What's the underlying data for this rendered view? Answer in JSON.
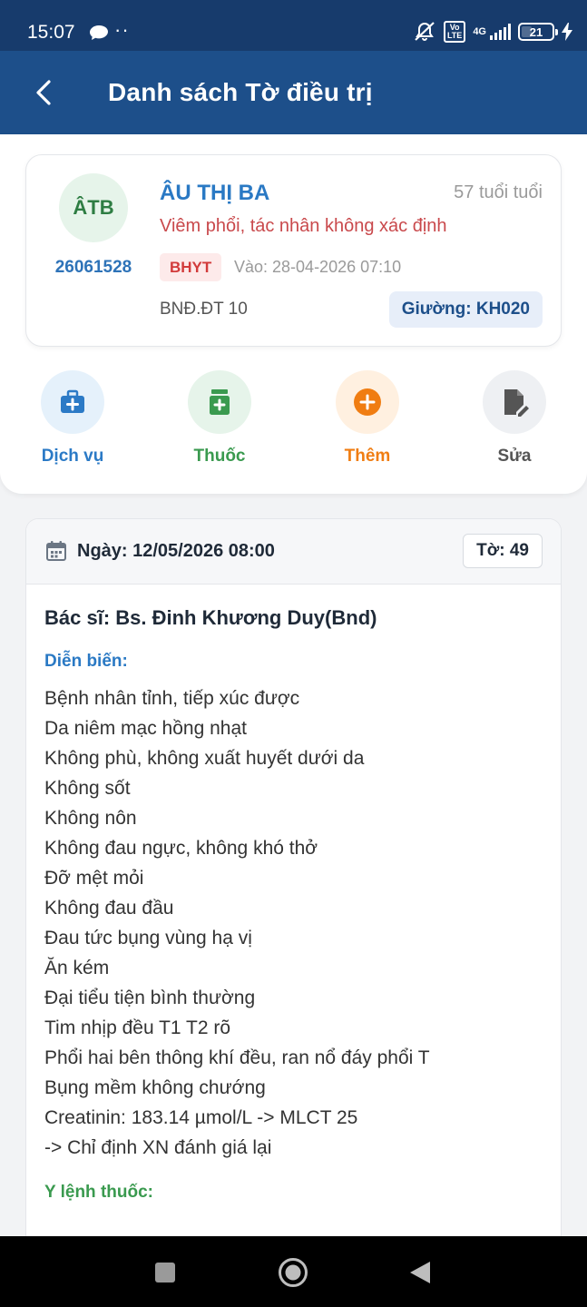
{
  "status_bar": {
    "time": "15:07",
    "dots": "··",
    "volte_top": "Vo",
    "volte_bottom": "LTE",
    "network": "4G",
    "battery_level": "21",
    "icons": [
      "chat-bubble-icon",
      "mute-icon",
      "signal-icon",
      "battery-icon",
      "charging-icon"
    ]
  },
  "header": {
    "title": "Danh sách Tờ điều trị",
    "back_icon": "chevron-left-icon"
  },
  "patient": {
    "initials": "ÂTB",
    "id": "26061528",
    "name": "ÂU THỊ BA",
    "age": "57 tuổi  tuổi",
    "diagnosis": "Viêm phổi, tác nhân không xác định",
    "insurance_badge": "BHYT",
    "admission": "Vào: 28-04-2026 07:10",
    "ward": "BNĐ.ĐT 10",
    "bed": "Giường: KH020"
  },
  "actions": [
    {
      "label": "Dịch vụ",
      "icon": "medical-kit-icon",
      "color": "#2b7ac6"
    },
    {
      "label": "Thuốc",
      "icon": "medicine-bottle-icon",
      "color": "#3a9a4f"
    },
    {
      "label": "Thêm",
      "icon": "plus-circle-icon",
      "color": "#f07d12"
    },
    {
      "label": "Sửa",
      "icon": "edit-document-icon",
      "color": "#555555"
    }
  ],
  "sheet": {
    "date": "Ngày: 12/05/2026 08:00",
    "sheet_no": "Tờ: 49",
    "doctor": "Bác sĩ: Bs. Đinh Khương Duy(Bnd)",
    "progress_title": "Diễn biến:",
    "progress": [
      "Bệnh nhân tỉnh, tiếp xúc được",
      "Da niêm mạc hồng nhạt",
      "Không phù, không xuất huyết dưới da",
      "Không sốt",
      "Không nôn",
      "Không đau ngực, không khó thở",
      "Đỡ mệt mỏi",
      "Không đau đầu",
      "Đau tức bụng vùng hạ vị",
      "Ăn kém",
      "Đại tiểu tiện bình thường",
      "Tim nhịp đều T1 T2 rõ",
      "Phổi hai bên thông khí đều, ran nổ đáy phổi T",
      "Bụng mềm không chướng",
      "Creatinin: 183.14 µmol/L -> MLCT 25",
      "-> Chỉ định XN đánh giá lại"
    ],
    "orders_title": "Y lệnh thuốc:"
  },
  "colors": {
    "status_bar": "#173b6c",
    "header": "#1d4f8a",
    "accent_blue": "#2a79c4",
    "diagnosis_red": "#c9494c",
    "green": "#3a9a4f",
    "orange": "#f07d12"
  }
}
